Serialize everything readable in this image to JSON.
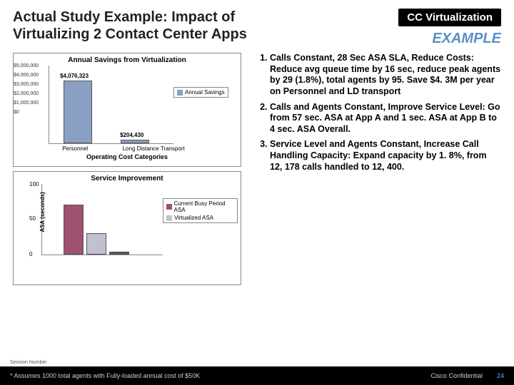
{
  "header": {
    "title": "Actual Study Example: Impact of Virtualizing 2 Contact Center Apps",
    "tag": "CC Virtualization",
    "example": "EXAMPLE"
  },
  "chart_data": [
    {
      "type": "bar",
      "title": "Annual Savings from Virtualization",
      "categories": [
        "Personnel",
        "Long Distance Transport"
      ],
      "values": [
        4076323,
        204430
      ],
      "value_labels": [
        "$4,076,323",
        "$204,430"
      ],
      "yticks": [
        "$0",
        "$1,000,000",
        "$2,000,000",
        "$3,000,000",
        "$4,000,000",
        "$5,000,000"
      ],
      "ylim": [
        0,
        5000000
      ],
      "legend": [
        "Annual Savings"
      ],
      "xlabel": "Operating Cost Categories",
      "colors": {
        "series": "#8a9fc4"
      }
    },
    {
      "type": "bar",
      "title": "Service Improvement",
      "categories": [
        ""
      ],
      "series": [
        {
          "name": "Current Busy Period ASA",
          "value": 70,
          "color": "#a05070"
        },
        {
          "name": "Virtualized ASA",
          "value": 30,
          "color": "#c0c0d0"
        },
        {
          "name": "",
          "value": 4,
          "color": "#556"
        }
      ],
      "yticks": [
        "0",
        "50",
        "100"
      ],
      "ylim": [
        0,
        100
      ],
      "ylabel": "ASA (seconds)"
    }
  ],
  "bullets": [
    "Calls Constant, 28 Sec ASA SLA, Reduce Costs:  Reduce avg queue time by 16 sec, reduce peak agents by 29 (1.8%), total agents by 95.  Save $4. 3M per year on Personnel and LD transport",
    "Calls and Agents Constant, Improve Service Level: Go from 57 sec. ASA at App A and 1 sec. ASA at App B to 4 sec. ASA Overall.",
    "Service Level and Agents Constant, Increase Call Handling Capacity:  Expand capacity by 1. 8%, from 12, 178 calls handled to 12, 400."
  ],
  "footer": {
    "footnote": "* Assumes 1000 total agents with Fully-loaded annual cost of $50K",
    "session_tag": "Session Number",
    "confidential": "Cisco Confidential",
    "page": "24"
  }
}
